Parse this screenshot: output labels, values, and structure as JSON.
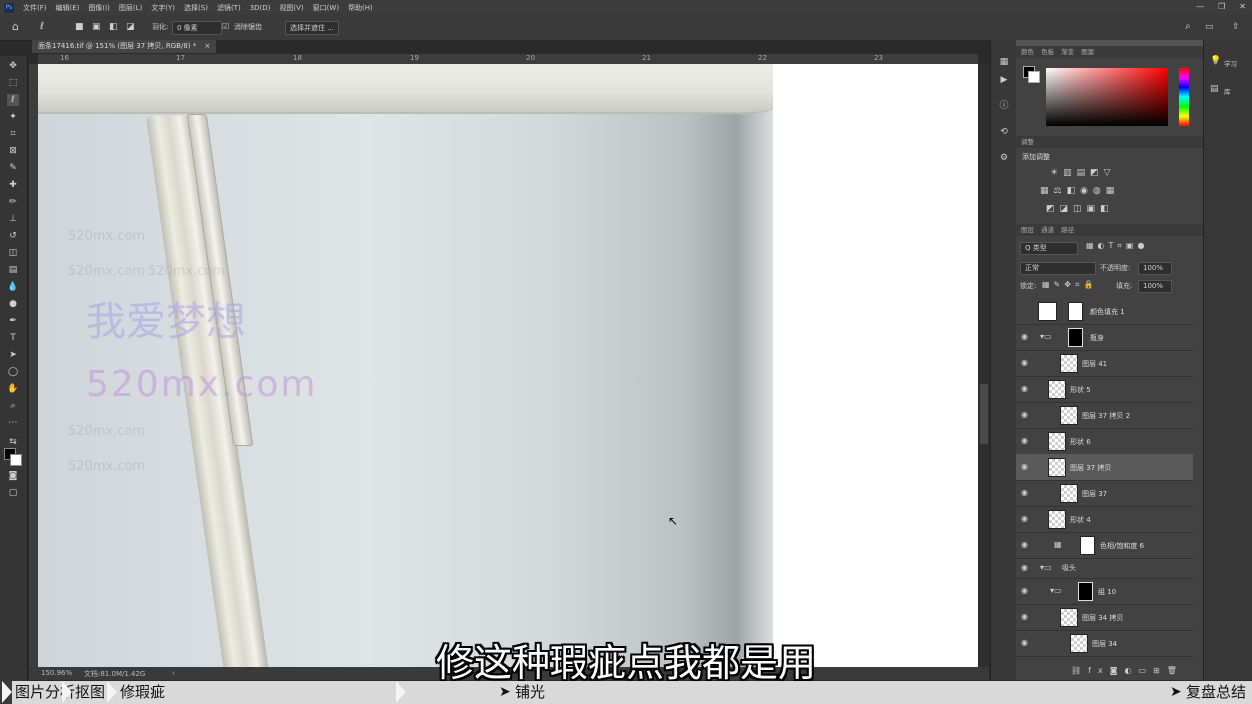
{
  "app": {
    "logo": "Ps"
  },
  "menu": [
    "文件(F)",
    "编辑(E)",
    "图像(I)",
    "图层(L)",
    "文字(Y)",
    "选择(S)",
    "滤镜(T)",
    "3D(D)",
    "视图(V)",
    "窗口(W)",
    "帮助(H)"
  ],
  "window_controls": [
    "—",
    "❐",
    "✕"
  ],
  "options_bar": {
    "feather_label": "羽化:",
    "feather_value": "0 像素",
    "antialias_label": "消除锯齿",
    "select_mask_button": "选择并遮住 ..."
  },
  "document_tab": {
    "title": "面条17416.tif @ 151% (图层 37 拷贝, RGB/8) *",
    "close": "×"
  },
  "ruler_top_labels": [
    "16",
    "17",
    "18",
    "19",
    "20",
    "21",
    "22",
    "23"
  ],
  "watermark": {
    "cn": "我爱梦想",
    "url": "520mx.com",
    "faint": "520mx.com"
  },
  "subtitle": "修这种瑕疵点我都是用",
  "status": {
    "zoom": "150.96%",
    "doc": "文档:81.0M/1.42G",
    "arrow": "›"
  },
  "panels": {
    "color_tabs": [
      "颜色",
      "色板",
      "渐变",
      "图案"
    ],
    "adjust_tabs": [
      "调整"
    ],
    "adjust_label": "添加调整",
    "layers_tabs": [
      "图层",
      "通道",
      "路径"
    ],
    "layers_filter": "Q 类型",
    "blend_mode": "正常",
    "opacity_label": "不透明度:",
    "opacity_value": "100%",
    "lock_label": "锁定:",
    "fill_label": "填充:",
    "fill_value": "100%",
    "layers": [
      {
        "name": "颜色填充 1",
        "selected": false
      },
      {
        "name": "瓶身",
        "selected": false
      },
      {
        "name": "图层 41",
        "selected": false
      },
      {
        "name": "形状 5",
        "selected": false
      },
      {
        "name": "图层 37 拷贝 2",
        "selected": false
      },
      {
        "name": "形状 6",
        "selected": false
      },
      {
        "name": "图层 37 拷贝",
        "selected": true
      },
      {
        "name": "图层 37",
        "selected": false
      },
      {
        "name": "形状 4",
        "selected": false
      },
      {
        "name": "色相/饱和度 6",
        "selected": false
      },
      {
        "name": "吸头",
        "selected": false
      },
      {
        "name": "组 10",
        "selected": false
      },
      {
        "name": "图层 34 拷贝",
        "selected": false
      },
      {
        "name": "图层 34",
        "selected": false
      }
    ]
  },
  "right_strip": {
    "item1": "学习",
    "item2": "库"
  },
  "nav": {
    "items": [
      "图片分析",
      "抠图",
      "修瑕疵",
      "铺光",
      "复盘总结"
    ]
  }
}
